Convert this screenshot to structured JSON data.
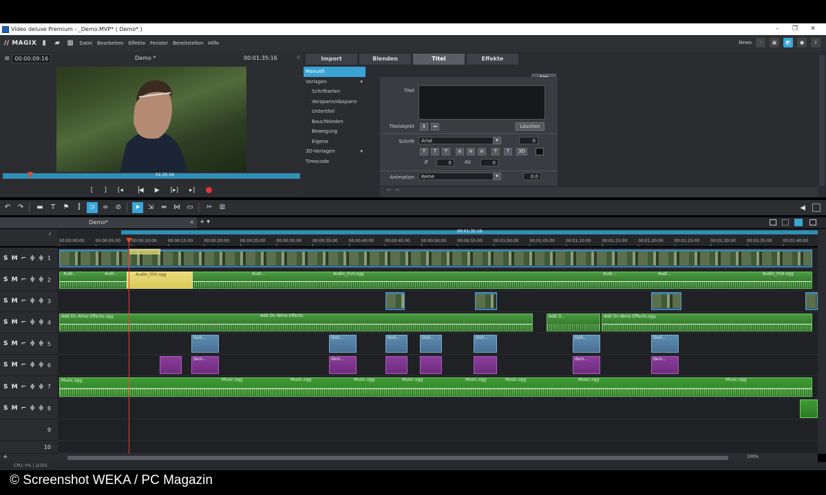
{
  "window": {
    "title": "Video deluxe Premium - _Demo.MVP* ( Demo* )",
    "min": "–",
    "max": "❐",
    "close": "✕"
  },
  "menu": {
    "logo": "// MAGIX",
    "items": [
      "Datei",
      "Bearbeiten",
      "Effekte",
      "Fenster",
      "Bereitstellen",
      "Hilfe"
    ],
    "news": "News"
  },
  "monitor": {
    "timecode_left": "00:00:09:16",
    "title": "Demo *",
    "timecode_right": "00:01:35:16",
    "scrub_label": "01:35:16"
  },
  "transport": {
    "buttons": [
      "[",
      "]",
      "[◂",
      "▕◀",
      "▶",
      "[▸]",
      "▸]"
    ]
  },
  "pool": {
    "tabs": [
      "Import",
      "Blenden",
      "Titel",
      "Effekte"
    ],
    "active_tab": "Titel",
    "tree": [
      {
        "label": "Manuell",
        "level": 0,
        "selected": true
      },
      {
        "label": "Vorlagen",
        "level": 0,
        "expander": "▾"
      },
      {
        "label": "Schriftarten",
        "level": 1
      },
      {
        "label": "Vorspann/Abspann",
        "level": 1
      },
      {
        "label": "Untertitel",
        "level": 1
      },
      {
        "label": "Bauchbinden",
        "level": 1
      },
      {
        "label": "Bewegung",
        "level": 1
      },
      {
        "label": "Eigene",
        "level": 1
      },
      {
        "label": "3D-Vorlagen",
        "level": 0,
        "expander": "▾"
      },
      {
        "label": "Timecode",
        "level": 0
      }
    ],
    "editor": {
      "titel_label": "Titel",
      "titelobjekt_label": "Titelobjekt",
      "loeschen": "Löschen",
      "schrift_label": "Schrift",
      "font": "Arial",
      "font_size": "0",
      "spacing1": "0",
      "av_label": "AV",
      "spacing2": "0",
      "animation_label": "Animation",
      "animation_value": "Keine",
      "animation_num": "0.0",
      "style_buttons": [
        "T",
        "T",
        "T",
        "≡",
        "≡",
        "≡",
        "T",
        "T",
        "3D"
      ]
    }
  },
  "timeline": {
    "project_tab": "Demo*",
    "ruler_top_label": "00:01:35:16",
    "ticks": [
      "00:00:00:00",
      "00:00:05:00",
      "00:00:10:00",
      "00:00:15:00",
      "00:00:20:00",
      "00:00:25:00",
      "00:00:30:00",
      "00:00:35:00",
      "00:00:40:00",
      "00:00:45:00",
      "00:00:50:00",
      "00:00:55:00",
      "00:01:00:00",
      "00:01:05:00",
      "00:01:10:00",
      "00:01:15:00",
      "00:01:20:00",
      "00:01:25:00",
      "00:01:30:00",
      "00:01:35:00",
      "00:01:40:00"
    ],
    "track_controls": "S M ⌐ ≑ ≑",
    "tracks": [
      "1",
      "2",
      "3",
      "4",
      "5",
      "6",
      "7",
      "8",
      "9",
      "10"
    ],
    "clips": {
      "audio_sel": "Audio_000.ogg",
      "audio_010": "Audio_010.ogg",
      "audio_016": "Audio_016.ogg",
      "audi": "Audi...",
      "atmo": "Add On Atmo Effects.ogg",
      "atmo_short": "Add O...",
      "title_short": "Ov0...",
      "purple_short": "dem...",
      "music": "Music.ogg"
    },
    "zoom": "100%"
  },
  "status": "CPU: 0% | 2/35S",
  "caption": "© Screenshot WEKA / PC Magazin"
}
